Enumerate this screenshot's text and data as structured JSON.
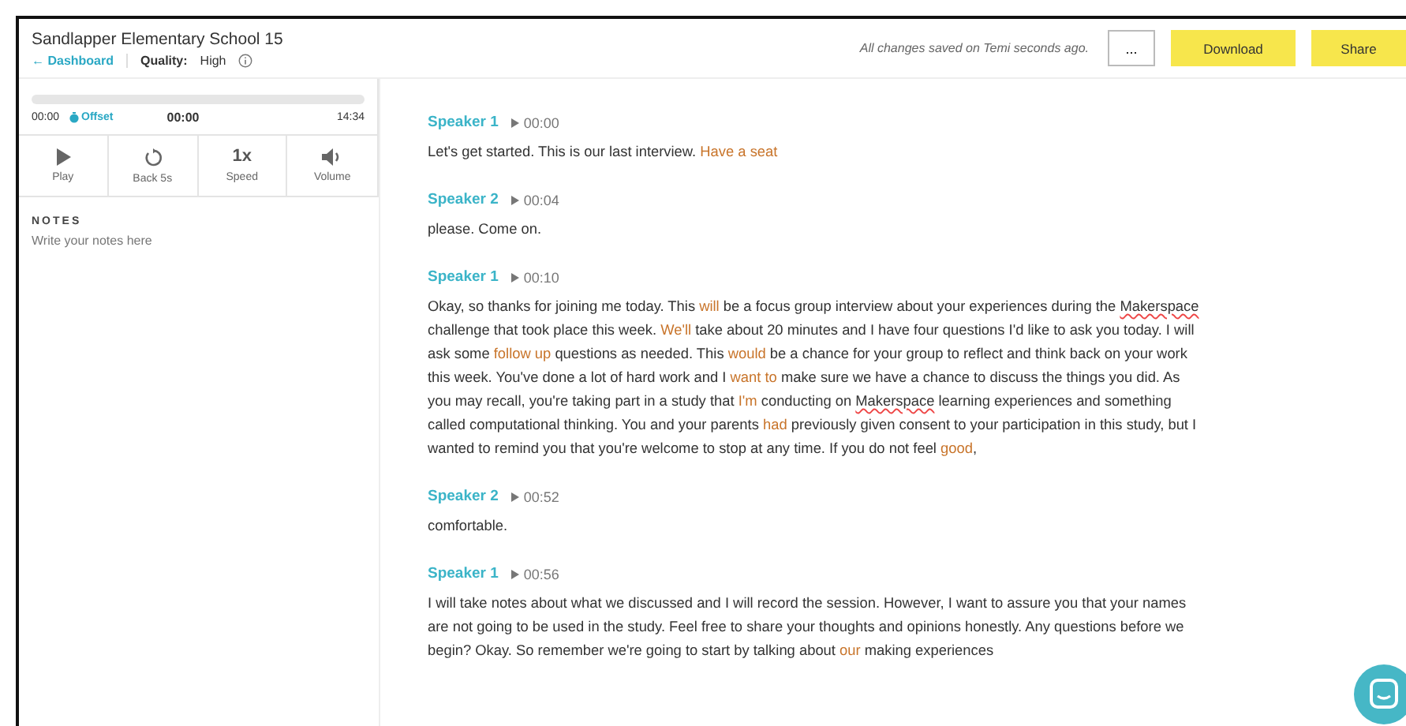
{
  "header": {
    "title": "Sandlapper Elementary School 15",
    "back_link": "← Dashboard",
    "quality_label": "Quality:",
    "quality_value": "High",
    "save_status": "All changes saved on Temi seconds ago.",
    "more_button": "...",
    "buttons": [
      {
        "label": "Download"
      },
      {
        "label": "Share"
      }
    ]
  },
  "player": {
    "start_time": "00:00",
    "offset_label": "Offset",
    "current_time": "00:00",
    "end_time": "14:34",
    "controls": [
      {
        "kind": "play",
        "label": "Play"
      },
      {
        "kind": "back",
        "label": "Back 5s"
      },
      {
        "kind": "speed",
        "label": "Speed",
        "value": "1x"
      },
      {
        "kind": "volume",
        "label": "Volume"
      }
    ]
  },
  "notes": {
    "heading": "NOTES",
    "placeholder": "Write your notes here"
  },
  "transcript": [
    {
      "speaker": "Speaker 1",
      "time": "00:00",
      "segments": [
        {
          "kind": "plain",
          "text": "Let's get started. This is our last interview. "
        },
        {
          "kind": "uncertain",
          "text": "Have a seat"
        }
      ]
    },
    {
      "speaker": "Speaker 2",
      "time": "00:04",
      "segments": [
        {
          "kind": "plain",
          "text": "please. Come on."
        }
      ]
    },
    {
      "speaker": "Speaker 1",
      "time": "00:10",
      "segments": [
        {
          "kind": "plain",
          "text": "Okay, so thanks for joining me today. This "
        },
        {
          "kind": "uncertain",
          "text": "will"
        },
        {
          "kind": "plain",
          "text": " be a focus group interview about your experiences during the "
        },
        {
          "kind": "misspelled",
          "text": "Makerspace"
        },
        {
          "kind": "plain",
          "text": " challenge that took place this week. "
        },
        {
          "kind": "uncertain",
          "text": "We'll"
        },
        {
          "kind": "plain",
          "text": " take about 20 minutes and I have four questions I'd like to ask you today. I will ask some "
        },
        {
          "kind": "uncertain",
          "text": "follow up"
        },
        {
          "kind": "plain",
          "text": " questions as needed. This "
        },
        {
          "kind": "uncertain",
          "text": "would"
        },
        {
          "kind": "plain",
          "text": " be a chance for your group to reflect and think back on your work this week. You've done a lot of hard work and I "
        },
        {
          "kind": "uncertain",
          "text": "want to"
        },
        {
          "kind": "plain",
          "text": " make sure we have a chance to discuss the things you did. As you may recall, you're taking part in a study that "
        },
        {
          "kind": "uncertain",
          "text": "I'm"
        },
        {
          "kind": "plain",
          "text": " conducting on "
        },
        {
          "kind": "misspelled",
          "text": "Makerspace"
        },
        {
          "kind": "plain",
          "text": " learning experiences and something called computational thinking. You and your parents "
        },
        {
          "kind": "uncertain",
          "text": "had"
        },
        {
          "kind": "plain",
          "text": " previously given consent to your participation in this study, but I wanted to remind you that you're welcome to stop at any time. If you do not feel "
        },
        {
          "kind": "uncertain",
          "text": "good"
        },
        {
          "kind": "plain",
          "text": ","
        }
      ]
    },
    {
      "speaker": "Speaker 2",
      "time": "00:52",
      "segments": [
        {
          "kind": "plain",
          "text": "comfortable."
        }
      ]
    },
    {
      "speaker": "Speaker 1",
      "time": "00:56",
      "segments": [
        {
          "kind": "plain",
          "text": "I will take notes about what we discussed and I will record the session. However, I want to assure you that your names are not going to be used in the study. Feel free to share your thoughts and opinions honestly. Any questions before we begin? Okay. So remember we're going to start by talking about "
        },
        {
          "kind": "uncertain",
          "text": "our"
        },
        {
          "kind": "plain",
          "text": " making experiences"
        }
      ]
    }
  ]
}
